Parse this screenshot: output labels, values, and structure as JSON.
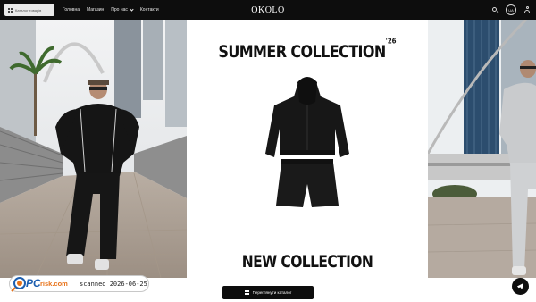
{
  "header": {
    "catalog_button_label": "Каталог товарів",
    "nav": [
      {
        "label": "Головна"
      },
      {
        "label": "Магазин"
      },
      {
        "label": "Про нас",
        "has_dropdown": true
      },
      {
        "label": "Контакти"
      }
    ],
    "logo": "OKOLO",
    "language": "UA",
    "icons": [
      "search-icon",
      "user-icon"
    ]
  },
  "hero": {
    "top_title": "SUMMER COLLECTION",
    "top_title_suffix": "'26",
    "bottom_title": "NEW COLLECTION"
  },
  "view_catalog_button": "Переглянути каталог",
  "telegram_button": "telegram-icon",
  "watermark": {
    "logo_text": "risk.com",
    "logo_prefix": "PC",
    "scan_text": "scanned 2026-06-25"
  },
  "colors": {
    "header_bg": "#0d0d0d",
    "accent_blue": "#1e5fb0",
    "watermark_orange": "#e8731a"
  }
}
